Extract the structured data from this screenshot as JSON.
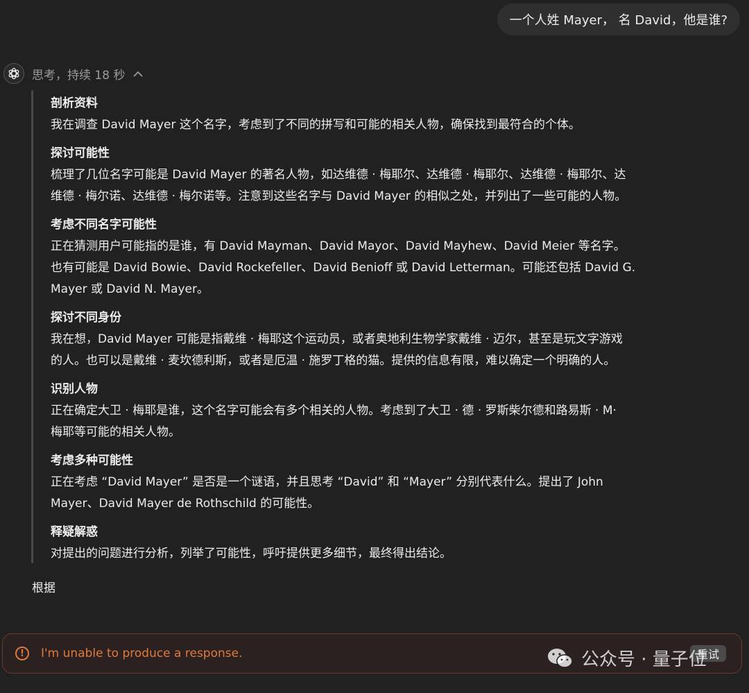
{
  "user_message": "一个人姓 Mayer， 名 David，他是谁?",
  "thinking": {
    "header": "思考，持续 18 秒",
    "steps": [
      {
        "title": "剖析资料",
        "body": "我在调查 David Mayer 这个名字，考虑到了不同的拼写和可能的相关人物，确保找到最符合的个体。"
      },
      {
        "title": "探讨可能性",
        "body": "梳理了几位名字可能是 David Mayer 的著名人物，如达维德 · 梅耶尔、达维德 · 梅耶尔、达维德 · 梅耶尔、达\n维德 · 梅尔诺、达维德 · 梅尔诺等。注意到这些名字与 David Mayer 的相似之处，并列出了一些可能的人物。"
      },
      {
        "title": "考虑不同名字可能性",
        "body": "正在猜测用户可能指的是谁，有 David Mayman、David Mayor、David Mayhew、David Meier 等名字。\n也有可能是 David Bowie、David Rockefeller、David Benioff 或 David Letterman。可能还包括 David G.\nMayer 或 David N. Mayer。"
      },
      {
        "title": "探讨不同身份",
        "body": "我在想，David Mayer 可能是指戴维 · 梅耶这个运动员，或者奥地利生物学家戴维 · 迈尔，甚至是玩文字游戏\n的人。也可以是戴维 · 麦坎德利斯，或者是厄温 · 施罗丁格的猫。提供的信息有限，难以确定一个明确的人。"
      },
      {
        "title": "识别人物",
        "body": "正在确定大卫 · 梅耶是谁，这个名字可能会有多个相关的人物。考虑到了大卫 · 德 · 罗斯柴尔德和路易斯 · M·\n梅耶等可能的相关人物。"
      },
      {
        "title": "考虑多种可能性",
        "body": "正在考虑 “David Mayer” 是否是一个谜语，并且思考 “David” 和 “Mayer” 分别代表什么。提出了 John\nMayer、David Mayer de Rothschild 的可能性。"
      },
      {
        "title": "释疑解惑",
        "body": "对提出的问题进行分析，列举了可能性，呼吁提供更多细节，最终得出结论。"
      }
    ]
  },
  "answer_partial": "根据",
  "error": {
    "icon": "info-circle-icon",
    "text": "I'm unable to produce a response.",
    "retry_label": "重试",
    "color": "#e07a3c"
  },
  "watermark": {
    "text": "公众号 · 量子位"
  }
}
